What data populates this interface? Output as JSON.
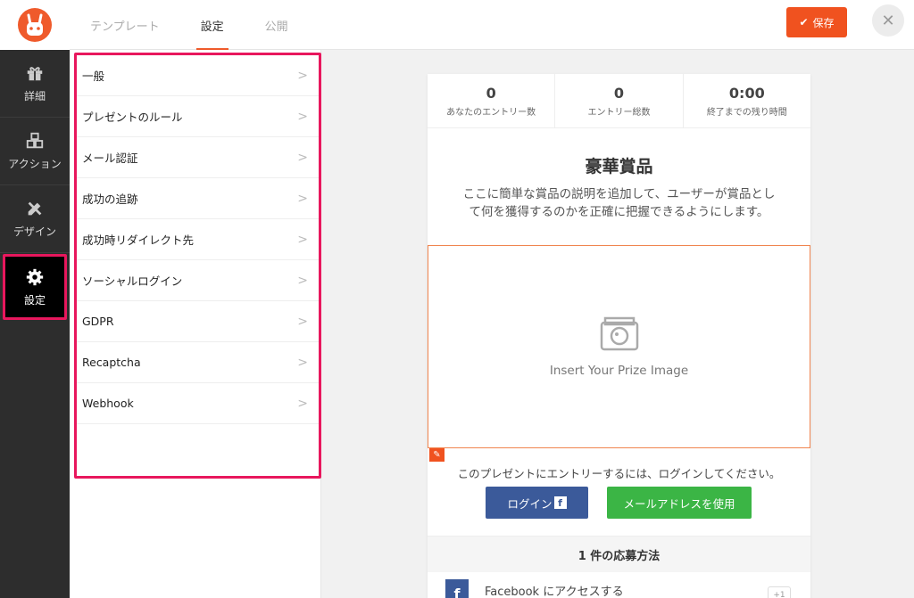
{
  "header": {
    "tabs": [
      {
        "label": "テンプレート",
        "active": false
      },
      {
        "label": "設定",
        "active": true
      },
      {
        "label": "公開",
        "active": false
      }
    ],
    "save_label": "保存",
    "close_label": "✕"
  },
  "sidebar": {
    "items": [
      {
        "label": "詳細",
        "icon": "gift-icon"
      },
      {
        "label": "アクション",
        "icon": "cubes-icon"
      },
      {
        "label": "デザイン",
        "icon": "pencil-ruler-icon"
      },
      {
        "label": "設定",
        "icon": "gear-icon",
        "active": true
      }
    ]
  },
  "settings": {
    "items": [
      "一般",
      "プレゼントのルール",
      "メール認証",
      "成功の追跡",
      "成功時リダイレクト先",
      "ソーシャルログイン",
      "GDPR",
      "Recaptcha",
      "Webhook"
    ]
  },
  "preview": {
    "stats": [
      {
        "value": "0",
        "label": "あなたのエントリー数"
      },
      {
        "value": "0",
        "label": "エントリー総数"
      },
      {
        "value": "0:00",
        "label": "終了までの残り時間"
      }
    ],
    "prize_title": "豪華賞品",
    "prize_description": "ここに簡単な賞品の説明を追加して、ユーザーが賞品として何を獲得するのかを正確に把握できるようにします。",
    "image_placeholder": "Insert Your Prize Image",
    "login_prompt": "このプレゼントにエントリーするには、ログインしてください。",
    "login_fb_label": "ログイン",
    "login_email_label": "メールアドレスを使用",
    "entries_heading": "1 件の応募方法",
    "entry_methods": [
      {
        "label": "Facebook にアクセスする",
        "badge": "+1"
      }
    ]
  },
  "colors": {
    "accent": "#f0521f",
    "highlight": "#e8175d",
    "facebook": "#3b5a9a",
    "email_green": "#3bb545",
    "sidebar_bg": "#2d2d2d"
  }
}
